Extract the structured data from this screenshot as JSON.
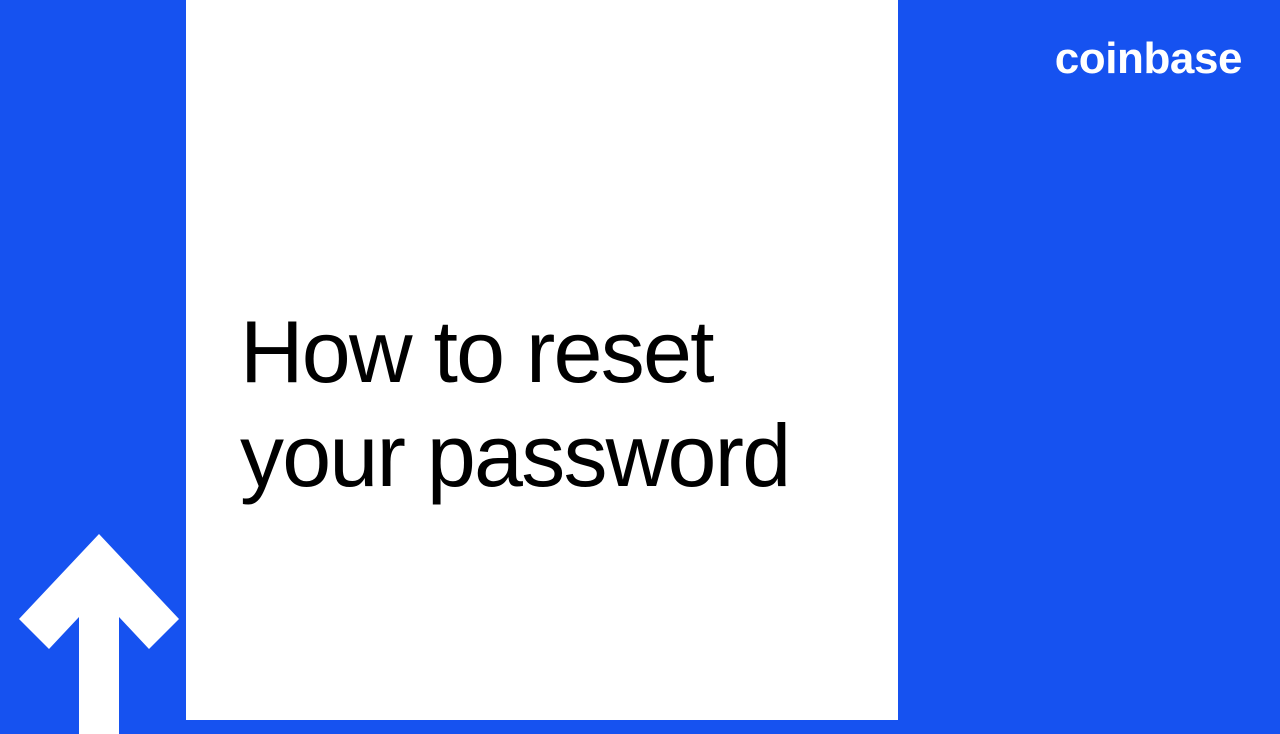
{
  "brand": "coinbase",
  "title_line1": "How to reset",
  "title_line2": "your password",
  "colors": {
    "background": "#1652f0",
    "panel": "#ffffff",
    "text": "#000000",
    "brand_text": "#ffffff"
  }
}
